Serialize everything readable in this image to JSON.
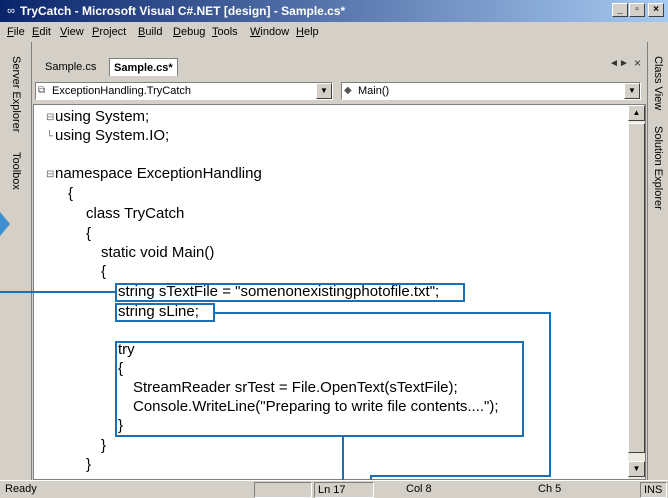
{
  "window": {
    "icon": "vs-app-icon",
    "title": "TryCatch - Microsoft Visual C#.NET [design] - Sample.cs*",
    "minimize": "_",
    "restore": "▫",
    "close": "×"
  },
  "menu": [
    "File",
    "Edit",
    "View",
    "Project",
    "Build",
    "Debug",
    "Tools",
    "Window",
    "Help"
  ],
  "left_dock": [
    "Server Explorer",
    "Toolbox"
  ],
  "right_dock": [
    "Class View",
    "Solution Explorer"
  ],
  "tabs": [
    {
      "label": "Sample.cs",
      "active": false
    },
    {
      "label": "Sample.cs*",
      "active": true
    }
  ],
  "tab_controls": {
    "prev": "◄",
    "next": "►",
    "close": "×"
  },
  "navbar": {
    "class_combo": "ExceptionHandling.TryCatch",
    "member_combo": "Main()",
    "class_icon": "class-icon",
    "member_icon": "method-icon",
    "dropdown": "▼"
  },
  "code": [
    "using System;",
    "using System.IO;",
    "",
    "namespace ExceptionHandling",
    "{",
    "class TryCatch",
    "{",
    "static void Main()",
    "{",
    "string sTextFile = \"somenonexistingphotofile.txt\";",
    "string sLine;",
    "",
    "try",
    "{",
    "StreamReader srTest = File.OpenText(sTextFile);",
    "Console.WriteLine(\"Preparing to write file contents....\");",
    "}",
    "}",
    "}"
  ],
  "fold_marks": {
    "minus": "⊟",
    "corner": "└"
  },
  "scrollbar": {
    "up": "▲",
    "down": "▼"
  },
  "status": {
    "message": "Ready",
    "line": "Ln 17",
    "col": "Col 8",
    "ch": "Ch 5",
    "mode": "INS"
  },
  "colors": {
    "callout": "#1a6fb5",
    "titlebar_start": "#0a246a",
    "titlebar_end": "#a6caf0"
  }
}
